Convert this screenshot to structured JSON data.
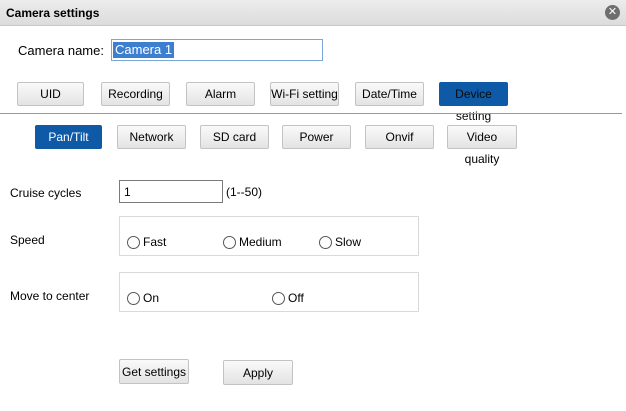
{
  "window": {
    "title": "Camera settings"
  },
  "camera": {
    "name_label": "Camera name:",
    "name_value": "Camera 1"
  },
  "tabs": [
    {
      "label": "UID"
    },
    {
      "label": "Recording"
    },
    {
      "label": "Alarm"
    },
    {
      "label": "Wi-Fi setting"
    },
    {
      "label": "Date/Time"
    },
    {
      "label": "Device setting",
      "active": true
    }
  ],
  "subtabs": [
    {
      "label": "Pan/Tilt",
      "active": true
    },
    {
      "label": "Network"
    },
    {
      "label": "SD card"
    },
    {
      "label": "Power"
    },
    {
      "label": "Onvif"
    },
    {
      "label": "Video quality"
    }
  ],
  "cruise": {
    "label": "Cruise cycles",
    "value": "1",
    "range": "(1--50)"
  },
  "speed": {
    "label": "Speed",
    "options": [
      "Fast",
      "Medium",
      "Slow"
    ]
  },
  "move_center": {
    "label": "Move to center",
    "options": [
      "On",
      "Off"
    ]
  },
  "actions": {
    "get_settings": "Get settings",
    "apply": "Apply"
  },
  "icons": {
    "close": "close-icon"
  },
  "colors": {
    "active_tab": "#0f5aa6",
    "selection": "#3c7fd1"
  }
}
